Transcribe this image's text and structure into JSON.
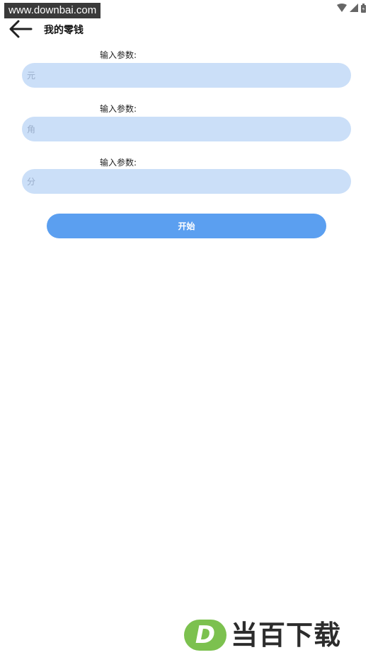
{
  "watermark": {
    "url_text": "www.downbai.com",
    "brand_mark": "D",
    "brand_text": "当百下载",
    "brand_color": "#7cc14f"
  },
  "status_bar": {
    "icons": [
      "wifi-icon",
      "signal-icon",
      "battery-icon"
    ]
  },
  "app_bar": {
    "back_icon": "arrow-left-icon",
    "title": "我的零钱"
  },
  "form": {
    "fields": [
      {
        "label": "输入参数:",
        "placeholder": "元",
        "value": ""
      },
      {
        "label": "输入参数:",
        "placeholder": "角",
        "value": ""
      },
      {
        "label": "输入参数:",
        "placeholder": "分",
        "value": ""
      }
    ],
    "start_label": "开始"
  },
  "colors": {
    "input_bg": "#cbdff8",
    "button_bg": "#5b9ff0"
  }
}
